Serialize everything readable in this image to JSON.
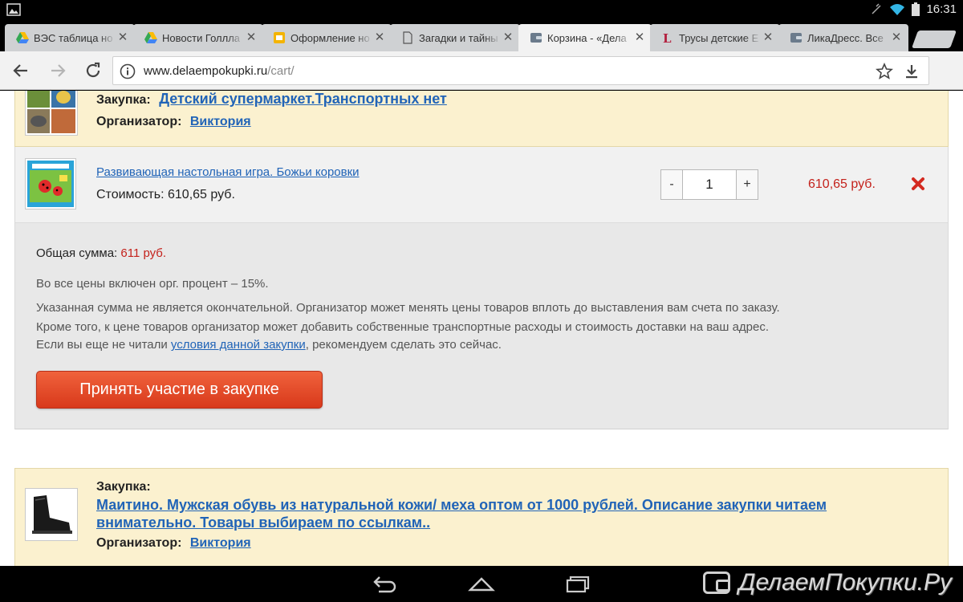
{
  "status_bar": {
    "time": "16:31"
  },
  "tabs": [
    {
      "label": "ВЭС таблица но",
      "icon": "google-drive-icon",
      "active": false
    },
    {
      "label": "Новости Голлла",
      "icon": "google-drive-icon",
      "active": false
    },
    {
      "label": "Оформление но",
      "icon": "google-slides-icon",
      "active": false
    },
    {
      "label": "Загадки и тайны",
      "icon": "document-icon",
      "active": false
    },
    {
      "label": "Корзина - «Дела",
      "icon": "wallet-icon",
      "active": true
    },
    {
      "label": "Трусы детские Е",
      "icon": "letter-l-icon",
      "active": false
    },
    {
      "label": "ЛикаДресс. Все",
      "icon": "wallet-icon",
      "active": false
    }
  ],
  "address_bar": {
    "host": "www.delaempokupki.ru",
    "path": "/cart/"
  },
  "purchase1": {
    "purchase_label": "Закупка:",
    "purchase_title": "Детский супермаркет.Транспортных нет",
    "organizer_label": "Организатор:",
    "organizer_name": "Виктория"
  },
  "cart_item": {
    "title": "Развивающая настольная игра. Божьи коровки",
    "cost_label": "Стоимость:",
    "cost_value": "610,65 руб.",
    "qty_minus": "-",
    "quantity": "1",
    "qty_plus": "+",
    "line_total": "610,65 руб."
  },
  "summary": {
    "total_label": "Общая сумма:",
    "total_value": "611 руб.",
    "fee_text": "Во все цены включен орг. процент  –  15%.",
    "note_line1": "Указанная сумма не является окончательной. Организатор может менять цены товаров вплоть до выставления вам счета по заказу.",
    "note_line2": "Кроме того, к цене товаров организатор может добавить собственные транспортные расходы и стоимость доставки на ваш адрес.",
    "note_line3_pre": "Если вы еще не читали ",
    "note_line3_link": "условия данной закупки",
    "note_line3_post": ", рекомендуем сделать это сейчас.",
    "cta_label": "Принять участие в закупке"
  },
  "purchase2": {
    "purchase_label": "Закупка:",
    "purchase_title_line1": "Маитино. Мужская обувь из натуральной кожи/ меха оптом от 1000 рублей. Описание закупки читаем",
    "purchase_title_line2": "внимательно. Товары выбираем по ссылкам..",
    "organizer_label": "Организатор:",
    "organizer_name": "Виктория"
  },
  "watermark": {
    "text": "ДелаемПокупки.Ру"
  },
  "colors": {
    "accent_red": "#c4221c",
    "link_blue": "#2164b7",
    "header_yellow": "#fbf1cf",
    "cta_orange": "#e44b27"
  }
}
